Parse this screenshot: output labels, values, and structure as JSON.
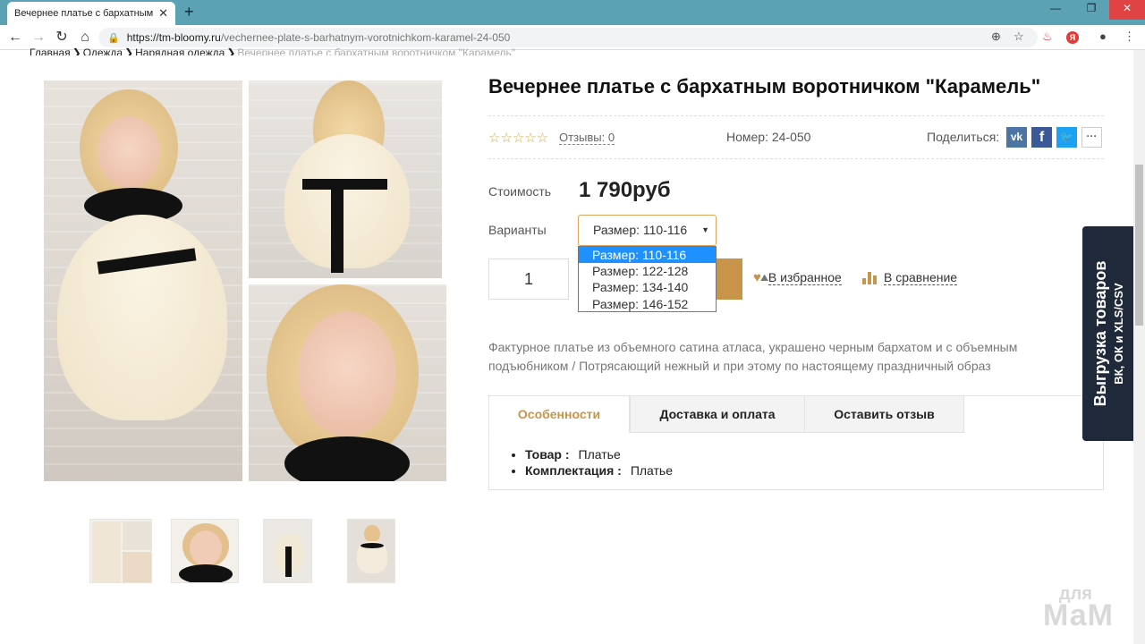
{
  "browser": {
    "tab_title": "Вечернее платье с бархатным в",
    "url_host": "https://tm-bloomy.ru",
    "url_path": "/vechernee-plate-s-barhatnym-vorotnichkom-karamel-24-050"
  },
  "breadcrumb": {
    "items": [
      "Главная",
      "Одежда",
      "Нарядная одежда"
    ],
    "current": "Вечернее платье с бархатным воротничком \"Карамель\""
  },
  "product": {
    "title": "Вечернее платье с бархатным воротничком \"Карамель\"",
    "reviews_link": "Отзывы: 0",
    "sku_label": "Номер:  24-050",
    "share_label": "Поделиться:",
    "price_label": "Стоимость",
    "price": "1 790руб",
    "variants_label": "Варианты",
    "variant_selected": "Размер: 110-116",
    "variant_options": [
      "Размер: 110-116",
      "Размер: 122-128",
      "Размер: 134-140",
      "Размер: 146-152"
    ],
    "quantity": "1",
    "favorite_label": "В избранное",
    "compare_label": "В сравнение",
    "description": "Фактурное платье из объемного сатина атласа, украшено черным бархатом и с объемным подъюбником / Потрясающий нежный и при этому по настоящему праздничный образ"
  },
  "tabs": [
    {
      "label": "Особенности"
    },
    {
      "label": "Доставка и оплата"
    },
    {
      "label": "Оставить отзыв"
    }
  ],
  "features": [
    {
      "name": "Товар :",
      "value": "Платье"
    },
    {
      "name": "Комплектация :",
      "value": "Платье"
    }
  ],
  "side_banner": {
    "line1": "Выгрузка товаров",
    "line2": "ВК, ОК и XLS/CSV"
  },
  "watermark": {
    "line1": "для",
    "line2": "МаМ"
  },
  "colors": {
    "accent": "#c8944a",
    "tabbar": "#5aa2b4",
    "banner": "#20293a"
  }
}
